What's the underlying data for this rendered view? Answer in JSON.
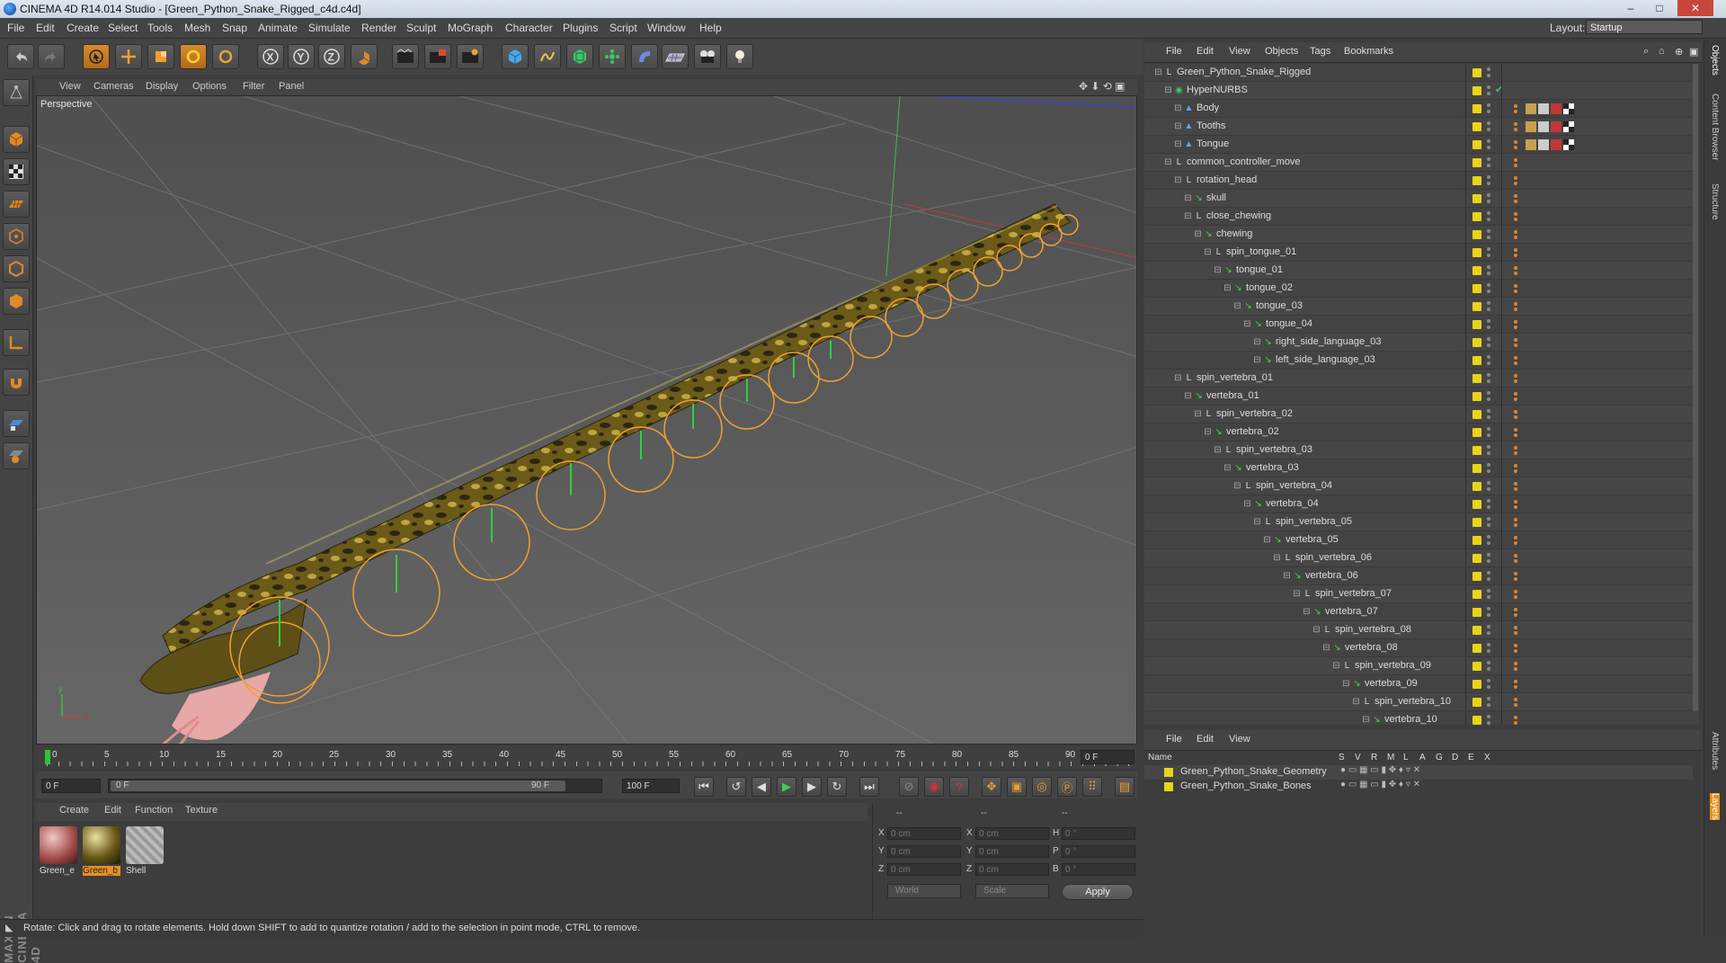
{
  "window": {
    "title": "CINEMA 4D R14.014 Studio - [Green_Python_Snake_Rigged_c4d.c4d]",
    "controls": {
      "minimize": "–",
      "maximize": "□",
      "close": "✕"
    }
  },
  "menubar": {
    "items": [
      "File",
      "Edit",
      "Create",
      "Select",
      "Tools",
      "Mesh",
      "Snap",
      "Animate",
      "Simulate",
      "Render",
      "Sculpt",
      "MoGraph",
      "Character",
      "Plugins",
      "Script",
      "Window",
      "Help"
    ],
    "layout_label": "Layout:",
    "layout_value": "Startup"
  },
  "viewport": {
    "menu": [
      "View",
      "Cameras",
      "Display",
      "Options",
      "Filter",
      "Panel"
    ],
    "label": "Perspective"
  },
  "timeline": {
    "ticks": [
      "0",
      "5",
      "10",
      "15",
      "20",
      "25",
      "30",
      "35",
      "40",
      "45",
      "50",
      "55",
      "60",
      "65",
      "70",
      "75",
      "80",
      "85",
      "90"
    ],
    "current_frame_field": "0 F",
    "start_field": "0 F",
    "range_start": "0 F",
    "range_end": "90 F",
    "end_field": "100 F"
  },
  "materials": {
    "menu": [
      "Create",
      "Edit",
      "Function",
      "Texture"
    ],
    "items": [
      {
        "label": "Green_e"
      },
      {
        "label": "Green_b"
      },
      {
        "label": "Shell"
      }
    ]
  },
  "coordinates": {
    "headers": [
      "--",
      "--",
      "--"
    ],
    "rows": [
      {
        "a": "X",
        "av": "0 cm",
        "b": "X",
        "bv": "0 cm",
        "c": "H",
        "cv": "0 °"
      },
      {
        "a": "Y",
        "av": "0 cm",
        "b": "Y",
        "bv": "0 cm",
        "c": "P",
        "cv": "0 °"
      },
      {
        "a": "Z",
        "av": "0 cm",
        "b": "Z",
        "bv": "0 cm",
        "c": "B",
        "cv": "0 °"
      }
    ],
    "mode1": "World",
    "mode2": "Scale",
    "apply": "Apply"
  },
  "status": "Rotate: Click and drag to rotate elements. Hold down SHIFT to add to quantize rotation / add to the selection in point mode, CTRL to remove.",
  "object_manager": {
    "menu": [
      "File",
      "Edit",
      "View",
      "Objects",
      "Tags",
      "Bookmarks"
    ],
    "objects": [
      {
        "name": "Green_Python_Snake_Rigged",
        "depth": 0,
        "icon": "null"
      },
      {
        "name": "HyperNURBS",
        "depth": 1,
        "icon": "nurbs"
      },
      {
        "name": "Body",
        "depth": 2,
        "icon": "poly"
      },
      {
        "name": "Tooths",
        "depth": 2,
        "icon": "poly"
      },
      {
        "name": "Tongue",
        "depth": 2,
        "icon": "poly"
      },
      {
        "name": "common_controller_move",
        "depth": 1,
        "icon": "null"
      },
      {
        "name": "rotation_head",
        "depth": 2,
        "icon": "null"
      },
      {
        "name": "skull",
        "depth": 3,
        "icon": "joint"
      },
      {
        "name": "close_chewing",
        "depth": 3,
        "icon": "null"
      },
      {
        "name": "chewing",
        "depth": 4,
        "icon": "joint"
      },
      {
        "name": "spin_tongue_01",
        "depth": 5,
        "icon": "null"
      },
      {
        "name": "tongue_01",
        "depth": 6,
        "icon": "joint"
      },
      {
        "name": "tongue_02",
        "depth": 7,
        "icon": "joint"
      },
      {
        "name": "tongue_03",
        "depth": 8,
        "icon": "joint"
      },
      {
        "name": "tongue_04",
        "depth": 9,
        "icon": "joint"
      },
      {
        "name": "right_side_language_03",
        "depth": 10,
        "icon": "joint"
      },
      {
        "name": "left_side_language_03",
        "depth": 10,
        "icon": "joint"
      },
      {
        "name": "spin_vertebra_01",
        "depth": 2,
        "icon": "null"
      },
      {
        "name": "vertebra_01",
        "depth": 3,
        "icon": "joint"
      },
      {
        "name": "spin_vertebra_02",
        "depth": 4,
        "icon": "null"
      },
      {
        "name": "vertebra_02",
        "depth": 5,
        "icon": "joint"
      },
      {
        "name": "spin_vertebra_03",
        "depth": 6,
        "icon": "null"
      },
      {
        "name": "vertebra_03",
        "depth": 7,
        "icon": "joint"
      },
      {
        "name": "spin_vertebra_04",
        "depth": 8,
        "icon": "null"
      },
      {
        "name": "vertebra_04",
        "depth": 9,
        "icon": "joint"
      },
      {
        "name": "spin_vertebra_05",
        "depth": 10,
        "icon": "null"
      },
      {
        "name": "vertebra_05",
        "depth": 11,
        "icon": "joint"
      },
      {
        "name": "spin_vertebra_06",
        "depth": 12,
        "icon": "null"
      },
      {
        "name": "vertebra_06",
        "depth": 13,
        "icon": "joint"
      },
      {
        "name": "spin_vertebra_07",
        "depth": 14,
        "icon": "null"
      },
      {
        "name": "vertebra_07",
        "depth": 15,
        "icon": "joint"
      },
      {
        "name": "spin_vertebra_08",
        "depth": 16,
        "icon": "null"
      },
      {
        "name": "vertebra_08",
        "depth": 17,
        "icon": "joint"
      },
      {
        "name": "spin_vertebra_09",
        "depth": 18,
        "icon": "null"
      },
      {
        "name": "vertebra_09",
        "depth": 19,
        "icon": "joint"
      },
      {
        "name": "spin_vertebra_10",
        "depth": 20,
        "icon": "null"
      },
      {
        "name": "vertebra_10",
        "depth": 21,
        "icon": "joint"
      }
    ]
  },
  "layer_manager": {
    "menu": [
      "File",
      "Edit",
      "View"
    ],
    "columns": [
      "Name",
      "S",
      "V",
      "R",
      "M",
      "L",
      "A",
      "G",
      "D",
      "E",
      "X"
    ],
    "layers": [
      {
        "name": "Green_Python_Snake_Geometry"
      },
      {
        "name": "Green_Python_Snake_Bones"
      }
    ]
  },
  "side_tabs": [
    "Objects",
    "Content Browser",
    "Structure",
    "Attributes",
    "Layers"
  ],
  "brand": "MAXON CINEMA 4D"
}
